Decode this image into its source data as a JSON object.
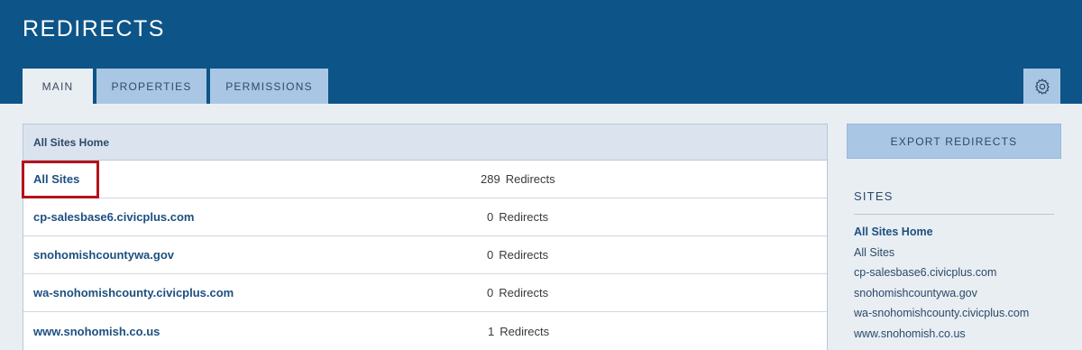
{
  "header": {
    "title": "REDIRECTS",
    "tabs": [
      {
        "label": "MAIN",
        "active": true
      },
      {
        "label": "PROPERTIES",
        "active": false
      },
      {
        "label": "PERMISSIONS",
        "active": false
      }
    ],
    "settings_icon": "gear-icon"
  },
  "table": {
    "header": "All Sites Home",
    "rows": [
      {
        "name": "All Sites",
        "count": "289",
        "unit": "Redirects",
        "highlighted": true
      },
      {
        "name": "cp-salesbase6.civicplus.com",
        "count": "0",
        "unit": "Redirects"
      },
      {
        "name": "snohomishcountywa.gov",
        "count": "0",
        "unit": "Redirects"
      },
      {
        "name": "wa-snohomishcounty.civicplus.com",
        "count": "0",
        "unit": "Redirects"
      },
      {
        "name": "www.snohomish.co.us",
        "count": "1",
        "unit": "Redirects"
      }
    ]
  },
  "sidebar": {
    "export_label": "EXPORT REDIRECTS",
    "sites_heading": "SITES",
    "sites": [
      "All Sites Home",
      "All Sites",
      "cp-salesbase6.civicplus.com",
      "snohomishcountywa.gov",
      "wa-snohomishcounty.civicplus.com",
      "www.snohomish.co.us"
    ]
  },
  "colors": {
    "header_bg": "#0d5488",
    "tab_inactive": "#a9c7e4",
    "highlight": "#b5121b"
  }
}
